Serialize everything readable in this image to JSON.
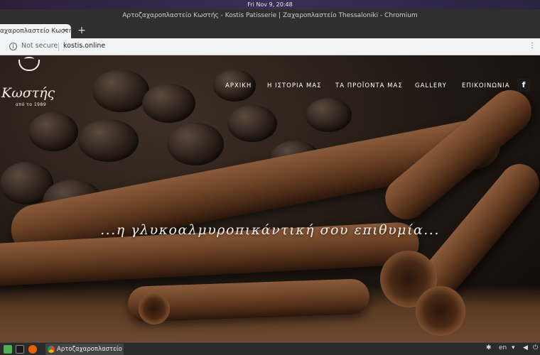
{
  "system": {
    "clock": "Fri Nov  9, 20:48"
  },
  "window": {
    "title": "Αρτοζαχαροπλαστείο Κωστής - Kostis Patisserie | Ζαχαροπλαστείο Thessaloniki - Chromium"
  },
  "tabs": [
    {
      "label": "αχαροπλαστείο Κωστή"
    }
  ],
  "tab_close_glyph": "×",
  "new_tab_glyph": "+",
  "address_bar": {
    "security_label": "Not secure",
    "url": "kostis.online"
  },
  "site": {
    "logo": {
      "name": "Κωστής",
      "since": "από το 1989"
    },
    "nav": [
      {
        "label": "ΑΡΧΙΚΗ"
      },
      {
        "label": "Η ΙΣΤΟΡΙΑ ΜΑΣ"
      },
      {
        "label": "ΤΑ ΠΡΟΪΟΝΤΑ ΜΑΣ"
      },
      {
        "label": "GALLERY"
      },
      {
        "label": "ΕΠΙΚΟΙΝΩΝΙΑ"
      }
    ],
    "facebook_glyph": "f",
    "slogan": "...η γλυκοαλμυροπικάντική σου επιθυμία..."
  },
  "taskbar": {
    "task_label": "Αρτοζαχαροπλαστείο Κ...",
    "language": "en"
  },
  "colors": {
    "nav_text": "#ffffff",
    "page_bg": "#1f1712",
    "cinnamon": "#6e4427"
  }
}
